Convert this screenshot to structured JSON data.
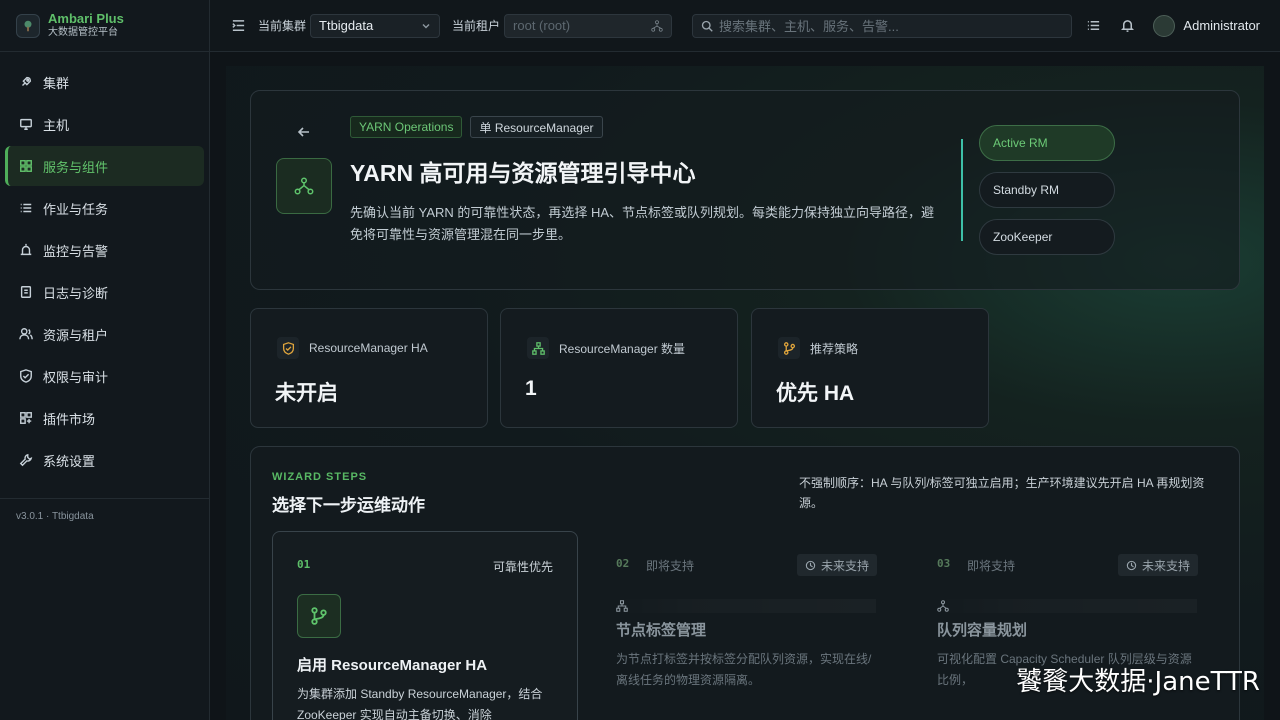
{
  "brand": {
    "title": "Ambari Plus",
    "subtitle": "大数据管控平台"
  },
  "sidebar": {
    "items": [
      {
        "label": "集群",
        "icon": "rocket-icon"
      },
      {
        "label": "主机",
        "icon": "monitor-icon"
      },
      {
        "label": "服务与组件",
        "icon": "grid-icon",
        "active": true
      },
      {
        "label": "作业与任务",
        "icon": "list-icon"
      },
      {
        "label": "监控与告警",
        "icon": "alarm-icon"
      },
      {
        "label": "日志与诊断",
        "icon": "log-icon"
      },
      {
        "label": "资源与租户",
        "icon": "users-icon"
      },
      {
        "label": "权限与审计",
        "icon": "shield-icon"
      },
      {
        "label": "插件市场",
        "icon": "apps-icon"
      },
      {
        "label": "系统设置",
        "icon": "wrench-icon"
      }
    ],
    "version": "v3.0.1 · Ttbigdata"
  },
  "topbar": {
    "cluster_label": "当前集群",
    "cluster_value": "Ttbigdata",
    "tenant_label": "当前租户",
    "tenant_value": "root (root)",
    "search_placeholder": "搜索集群、主机、服务、告警...",
    "user": "Administrator"
  },
  "hero": {
    "tag1": "YARN Operations",
    "tag2": "单 ResourceManager",
    "title": "YARN 高可用与资源管理引导中心",
    "description": "先确认当前 YARN 的可靠性状态，再选择 HA、节点标签或队列规划。每类能力保持独立向导路径，避免将可靠性与资源管理混在同一步里。",
    "pills": [
      "Active RM",
      "Standby RM",
      "ZooKeeper"
    ]
  },
  "stats": [
    {
      "label": "ResourceManager HA",
      "value": "未开启",
      "icon": "shield-check-icon",
      "color": "#e0a53c"
    },
    {
      "label": "ResourceManager 数量",
      "value": "1",
      "icon": "sitemap-icon",
      "color": "#5fbf6a"
    },
    {
      "label": "推荐策略",
      "value": "优先 HA",
      "icon": "branch-icon",
      "color": "#e0a53c"
    }
  ],
  "wizard": {
    "kicker": "WIZARD STEPS",
    "title": "选择下一步运维动作",
    "note": "不强制顺序：HA 与队列/标签可独立启用；生产环境建议先开启 HA 再规划资源。",
    "steps": [
      {
        "num": "01",
        "right": "可靠性优先",
        "title": "启用 ResourceManager HA",
        "desc": "为集群添加 Standby ResourceManager，结合 ZooKeeper 实现自动主备切换、消除"
      },
      {
        "num": "02",
        "soon": "即将支持",
        "badge": "未来支持",
        "title": "节点标签管理",
        "desc": "为节点打标签并按标签分配队列资源，实现在线/离线任务的物理资源隔离。"
      },
      {
        "num": "03",
        "soon": "即将支持",
        "badge": "未来支持",
        "title": "队列容量规划",
        "desc": "可视化配置 Capacity Scheduler 队列层级与资源比例，"
      }
    ]
  },
  "watermark": "饕餮大数据·JaneTTR"
}
